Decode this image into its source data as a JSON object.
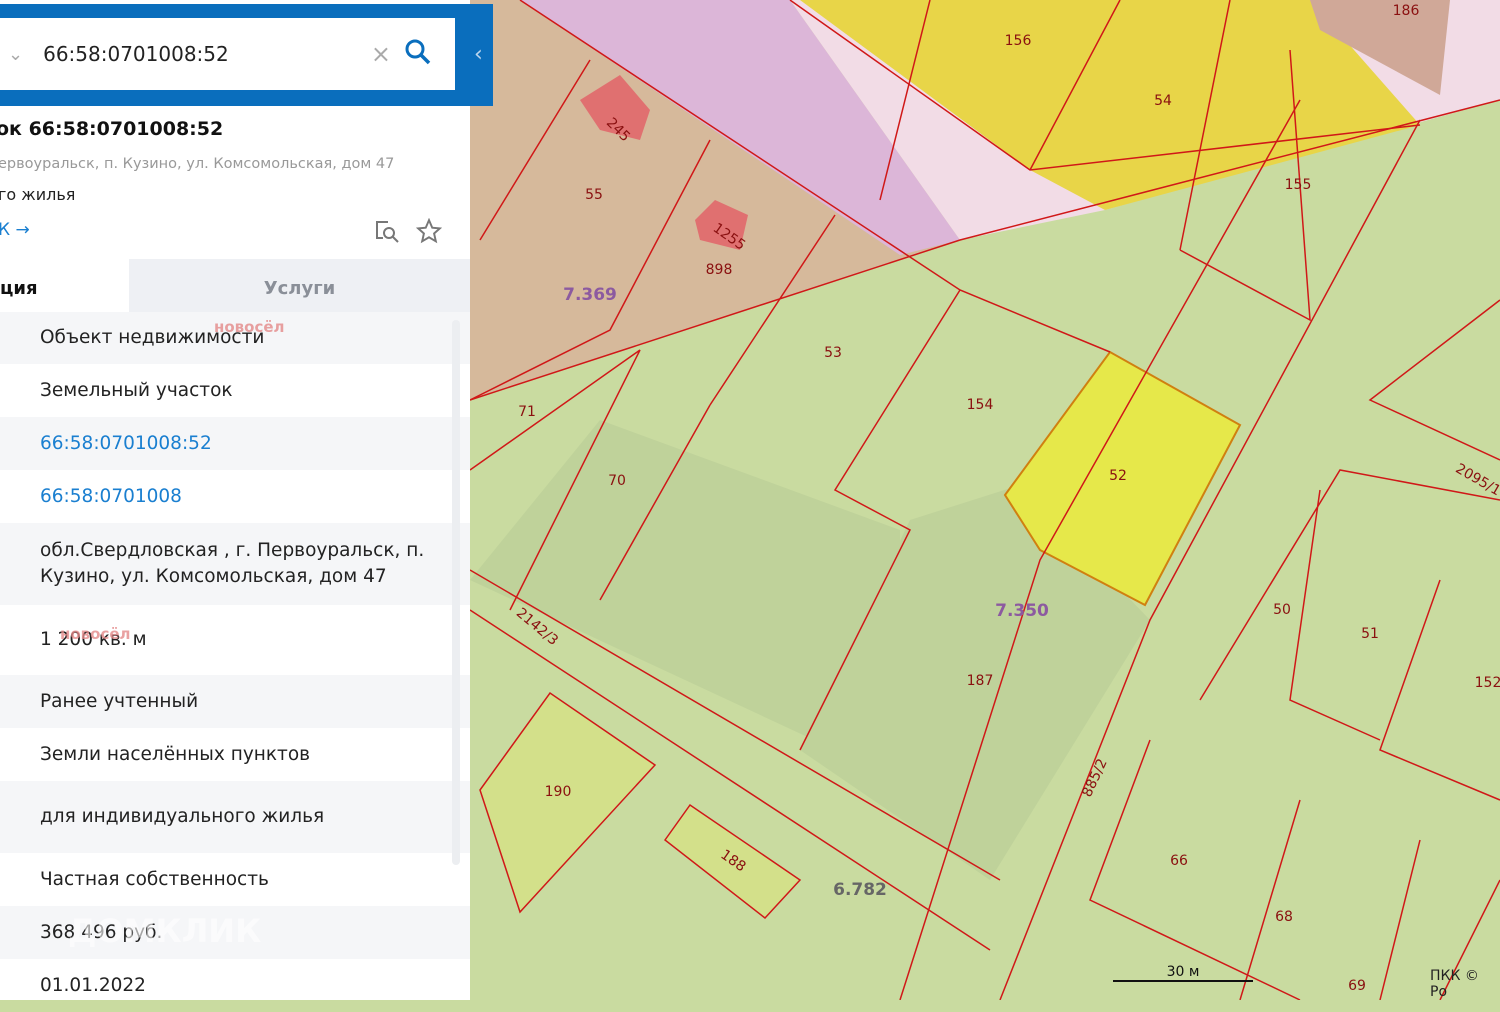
{
  "search": {
    "value": "66:58:0701008:52",
    "icon": "search-icon",
    "clear_icon": "close-icon",
    "dropdown_icon": "chevron-down-icon"
  },
  "panel": {
    "title": "ок 66:58:0701008:52",
    "address": "ервоуральск, п. Кузино, ул. Комсомольская, дом 47",
    "use": "го жилья",
    "link": "К →",
    "collapse_icon": "chevron-left-icon",
    "icons": [
      "map-search-icon",
      "star-icon"
    ]
  },
  "tabs": [
    {
      "label": "ция",
      "active": true
    },
    {
      "label": "Услуги",
      "active": false
    }
  ],
  "rows": [
    {
      "value": "Объект недвижимости"
    },
    {
      "value": "Земельный участок"
    },
    {
      "value": "66:58:0701008:52",
      "link": true
    },
    {
      "value": "66:58:0701008",
      "link": true
    },
    {
      "value": "обл.Свердловская , г. Первоуральск, п. Кузино, ул. Комсомольская, дом 47"
    },
    {
      "value": "1 200 кв. м"
    },
    {
      "value": "Ранее учтенный"
    },
    {
      "value": "Земли населённых пунктов"
    },
    {
      "value": "для индивидуального жилья"
    },
    {
      "value": "Частная собственность"
    },
    {
      "value": "368 496 руб."
    },
    {
      "value": "01.01.2022"
    }
  ],
  "watermarks": {
    "novosel": "новосёл",
    "domclick": "ДОМКЛИК"
  },
  "map": {
    "colors": {
      "selected": "#e6e84a",
      "residential": "#e8d548",
      "green": "#c9dba0",
      "brown": "#d6b99b",
      "pink": "#f2dce6",
      "border": "#d01818"
    },
    "labels": [
      "156",
      "186",
      "54",
      "245",
      "55",
      "1255",
      "898",
      "155",
      "7.369",
      "53",
      "154",
      "71",
      "70",
      "52",
      "2095/1",
      "7.350",
      "50",
      "51",
      "152",
      "2142/3",
      "187",
      "190",
      "885/2",
      "188",
      "6.782",
      "66",
      "68",
      "69",
      "30"
    ],
    "quarter_labels": [
      "7.369",
      "7.350",
      "6.782"
    ],
    "scale": "30 м",
    "attribution": "ПКК © Ро"
  }
}
